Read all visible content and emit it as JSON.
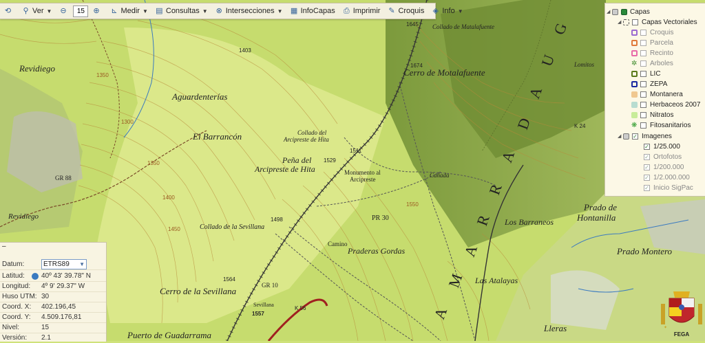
{
  "toolbar": {
    "ver": "Ver",
    "zoom_value": "15",
    "medir": "Medir",
    "consultas": "Consultas",
    "intersecciones": "Intersecciones",
    "infocapas": "InfoCapas",
    "imprimir": "Imprimir",
    "croquis": "Croquis",
    "info": "Info"
  },
  "layers": {
    "root": "Capas",
    "vectoriales": "Capas Vectoriales",
    "items": [
      {
        "label": "Croquis",
        "color": "#9a6ad0",
        "checked": false,
        "enabled": false
      },
      {
        "label": "Parcela",
        "color": "#e07a3a",
        "checked": false,
        "enabled": false
      },
      {
        "label": "Recinto",
        "color": "#e86aa8",
        "checked": false,
        "enabled": false
      },
      {
        "label": "Arboles",
        "color": "#3c8a2a",
        "checked": false,
        "enabled": false
      },
      {
        "label": "LIC",
        "color": "#5a7a1a",
        "checked": false,
        "enabled": true
      },
      {
        "label": "ZEPA",
        "color": "#1a2aa0",
        "checked": false,
        "enabled": true
      },
      {
        "label": "Montanera",
        "color": "#f0c890",
        "checked": false,
        "enabled": true
      },
      {
        "label": "Herbaceos 2007",
        "color": "#b8dcd0",
        "checked": false,
        "enabled": true
      },
      {
        "label": "Nitratos",
        "color": "#c8ec9a",
        "checked": false,
        "enabled": true
      },
      {
        "label": "Fitosanitarios",
        "color": "#2a9a2a",
        "checked": false,
        "enabled": true
      }
    ],
    "imagenes": "Imagenes",
    "image_items": [
      {
        "label": "1/25.000",
        "checked": true,
        "enabled": true
      },
      {
        "label": "Ortofotos",
        "checked": true,
        "enabled": false
      },
      {
        "label": "1/200.000",
        "checked": true,
        "enabled": false
      },
      {
        "label": "1/2.000.000",
        "checked": true,
        "enabled": false
      },
      {
        "label": "Inicio SigPac",
        "checked": true,
        "enabled": false
      }
    ]
  },
  "coords": {
    "datum_label": "Datum:",
    "datum_value": "ETRS89",
    "latitud_label": "Latitud:",
    "latitud_value": "40º 43' 39.78\" N",
    "longitud_label": "Longitud:",
    "longitud_value": "4º 9' 29.37\" W",
    "huso_label": "Huso UTM:",
    "huso_value": "30",
    "x_label": "Coord. X:",
    "x_value": "402.196,45",
    "y_label": "Coord. Y:",
    "y_value": "4.509.176,81",
    "nivel_label": "Nivel:",
    "nivel_value": "15",
    "version_label": "Versión:",
    "version_value": "2.1"
  },
  "fega": "FEGA",
  "map_labels": {
    "revidiego": "Revidiego",
    "revidiego2": "Revidiego",
    "aguardenterias": "Aguardenterías",
    "barrancon": "El Barrancón",
    "pena1": "Peña del",
    "pena2": "Arcipreste de Hita",
    "collado_arci1": "Collado del",
    "collado_arci2": "Arcipreste de Hita",
    "monumento1": "Monumento al",
    "monumento2": "Arcipreste",
    "collado_sevillana": "Collado de la Sevillana",
    "cerro_sevillana": "Cerro de la Sevillana",
    "sevillana": "Sevillana",
    "puerto": "Puerto de Guadarrama",
    "collado_mata": "Collado de Matalafuente",
    "cerro_mata": "Cerro de Motalafuente",
    "lomitos": "Lomitos",
    "praderas": "Praderas Gordas",
    "atalayas": "Las Atalayas",
    "barraneos": "Los Barraneos",
    "prado_hont1": "Prado de",
    "prado_hont2": "Hontanilla",
    "prado_montero": "Prado Montero",
    "lleras": "Lleras",
    "canada": "Cañada",
    "camino": "Camino",
    "pr30": "PR 30",
    "gr88": "GR 88",
    "gr10": "GR 10",
    "h1403": "1403",
    "h1645": "1645",
    "h1674": "1674",
    "h1511": "1511",
    "h1529": "1529",
    "h1498": "1498",
    "h1564": "1564",
    "h1557": "1557",
    "c1350": "1350",
    "c1300": "1300",
    "c1400": "1400",
    "c1450": "1450",
    "c1550": "1550",
    "k24": "K 24",
    "k56": "K 56",
    "guadarrama": [
      "G",
      "U",
      "A",
      "D",
      "A",
      "R",
      "R",
      "A",
      "M",
      "A"
    ]
  }
}
